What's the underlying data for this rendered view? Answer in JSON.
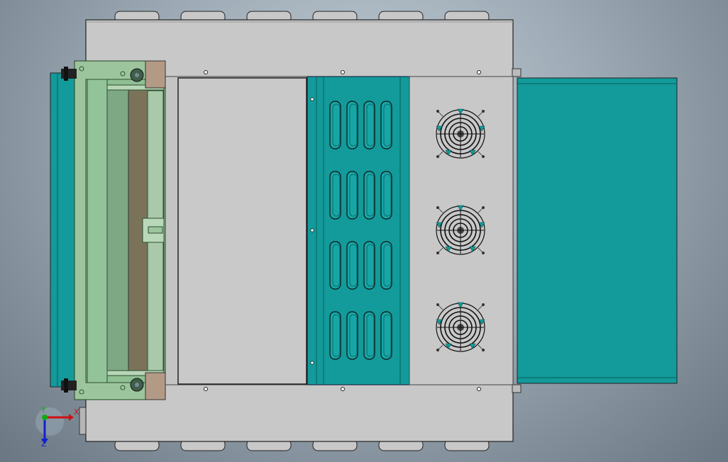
{
  "viewport": {
    "background_colors": [
      "#c3ced6",
      "#9eabb6",
      "#6a7782"
    ]
  },
  "model": {
    "body_color": "#c8c8c8",
    "teal_color": "#139a9a",
    "green_color": "#9cc59e",
    "fan_count": 3,
    "vent_rows": 4,
    "vent_columns": 4,
    "top_tabs": 6,
    "bottom_tabs": 6
  },
  "triad": {
    "x_label": "X",
    "y_label": "Y",
    "z_label": "Z",
    "x_color": "#cc1111",
    "y_color": "#11aa11",
    "z_color": "#1122cc"
  }
}
